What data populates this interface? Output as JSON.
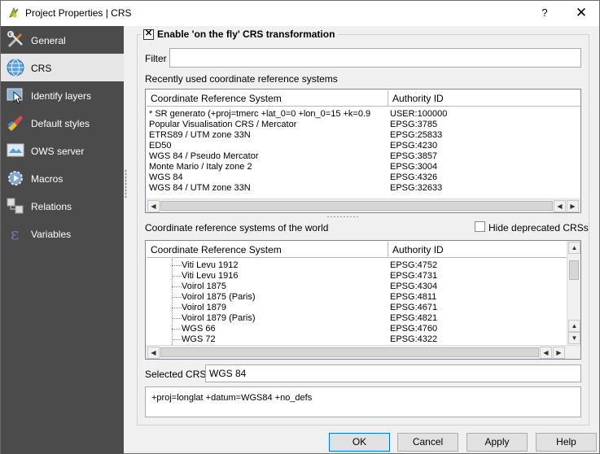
{
  "window": {
    "title": "Project Properties | CRS",
    "help_label": "?",
    "close_label": "✕"
  },
  "sidebar": {
    "items": [
      {
        "label": "General",
        "icon": "wrench-screwdriver-icon"
      },
      {
        "label": "CRS",
        "icon": "globe-icon"
      },
      {
        "label": "Identify layers",
        "icon": "identify-cursor-icon"
      },
      {
        "label": "Default styles",
        "icon": "paint-brush-icon"
      },
      {
        "label": "OWS server",
        "icon": "map-server-icon"
      },
      {
        "label": "Macros",
        "icon": "gear-play-icon"
      },
      {
        "label": "Relations",
        "icon": "relations-table-icon"
      },
      {
        "label": "Variables",
        "icon": "epsilon-icon"
      }
    ],
    "active_index": 1
  },
  "crs": {
    "otf_label": "Enable 'on the fly' CRS transformation",
    "otf_checked": true,
    "filter_label": "Filter",
    "filter_value": "",
    "recent_label": "Recently used coordinate reference systems",
    "recent_headers": [
      "Coordinate Reference System",
      "Authority ID"
    ],
    "recent_rows": [
      {
        "name": " * SR generato (+proj=tmerc +lat_0=0 +lon_0=15 +k=0.9",
        "id": "USER:100000"
      },
      {
        "name": "Popular Visualisation CRS / Mercator",
        "id": "EPSG:3785"
      },
      {
        "name": "ETRS89 / UTM zone 33N",
        "id": "EPSG:25833"
      },
      {
        "name": "ED50",
        "id": "EPSG:4230"
      },
      {
        "name": "WGS 84 / Pseudo Mercator",
        "id": "EPSG:3857"
      },
      {
        "name": "Monte Mario / Italy zone 2",
        "id": "EPSG:3004"
      },
      {
        "name": "WGS 84",
        "id": "EPSG:4326"
      },
      {
        "name": "WGS 84 / UTM zone 33N",
        "id": "EPSG:32633"
      }
    ],
    "world_label": "Coordinate reference systems of the world",
    "hide_deprecated_label": "Hide deprecated CRSs",
    "hide_deprecated_checked": false,
    "world_headers": [
      "Coordinate Reference System",
      "Authority ID"
    ],
    "world_rows": [
      {
        "name": "Viti Levu 1912",
        "id": "EPSG:4752"
      },
      {
        "name": "Viti Levu 1916",
        "id": "EPSG:4731"
      },
      {
        "name": "Voirol 1875",
        "id": "EPSG:4304"
      },
      {
        "name": "Voirol 1875 (Paris)",
        "id": "EPSG:4811"
      },
      {
        "name": "Voirol 1879",
        "id": "EPSG:4671"
      },
      {
        "name": "Voirol 1879 (Paris)",
        "id": "EPSG:4821"
      },
      {
        "name": "WGS 66",
        "id": "EPSG:4760"
      },
      {
        "name": "WGS 72",
        "id": "EPSG:4322"
      }
    ],
    "selected_label": "Selected CRS:",
    "selected_value": "WGS 84",
    "proj_string": "+proj=longlat +datum=WGS84 +no_defs"
  },
  "buttons": {
    "ok": "OK",
    "cancel": "Cancel",
    "apply": "Apply",
    "help": "Help"
  },
  "colors": {
    "sidebar_bg": "#4b4b4b",
    "sidebar_active": "#e6e6e6",
    "default_button_border": "#0078d7"
  }
}
